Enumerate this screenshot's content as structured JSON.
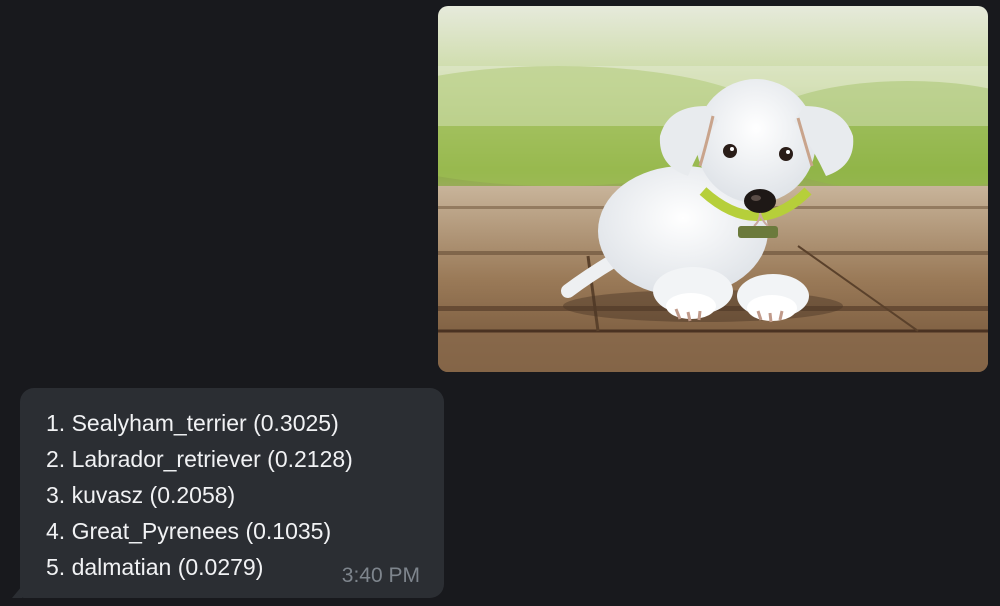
{
  "image_message": {
    "icon": "puppy-photo"
  },
  "text_message": {
    "predictions": [
      "1. Sealyham_terrier (0.3025)",
      "2. Labrador_retriever (0.2128)",
      "3. kuvasz (0.2058)",
      "4. Great_Pyrenees (0.1035)",
      "5. dalmatian (0.0279)"
    ],
    "timestamp": "3:40 PM"
  },
  "colors": {
    "background": "#18191d",
    "bubble": "#2b2e33",
    "text": "#f1f2f4",
    "timestamp": "#7e858d"
  }
}
